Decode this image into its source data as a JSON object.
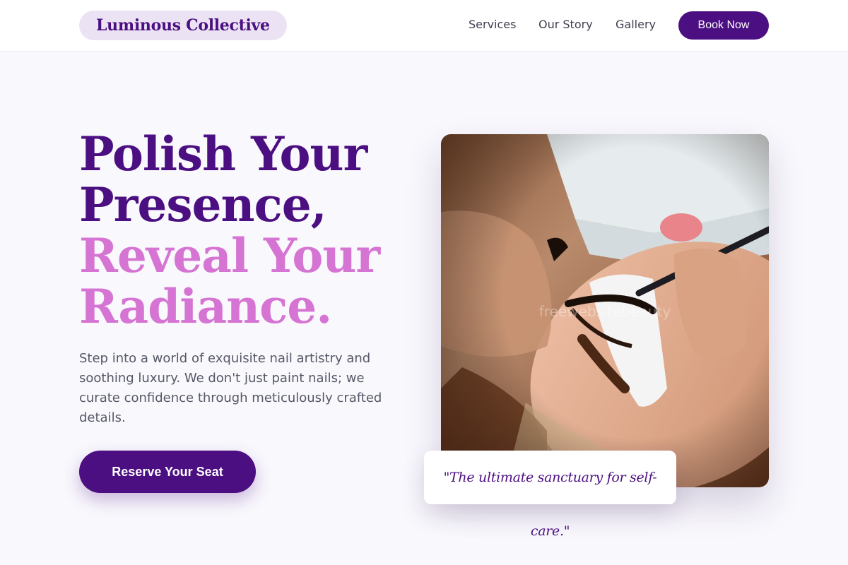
{
  "header": {
    "brand": "Luminous Collective",
    "nav": {
      "services": "Services",
      "story": "Our Story",
      "gallery": "Gallery"
    },
    "cta": "Book Now"
  },
  "hero": {
    "headline_line1": "Polish Your",
    "headline_line2": "Presence,",
    "headline_line3": "Reveal Your",
    "headline_line4": "Radiance.",
    "description": "Step into a world of exquisite nail artistry and soothing luxury. We don't just paint nails; we curate confidence through meticulously crafted details.",
    "cta": "Reserve Your Seat",
    "image_watermark": "freewebsitebeauty",
    "quote": "\"The ultimate sanctuary for self-care.\""
  },
  "colors": {
    "primary": "#4b0f82",
    "accent": "#d674d3",
    "brand_pill": "#ebe3f3",
    "background": "#f9f8fd"
  }
}
